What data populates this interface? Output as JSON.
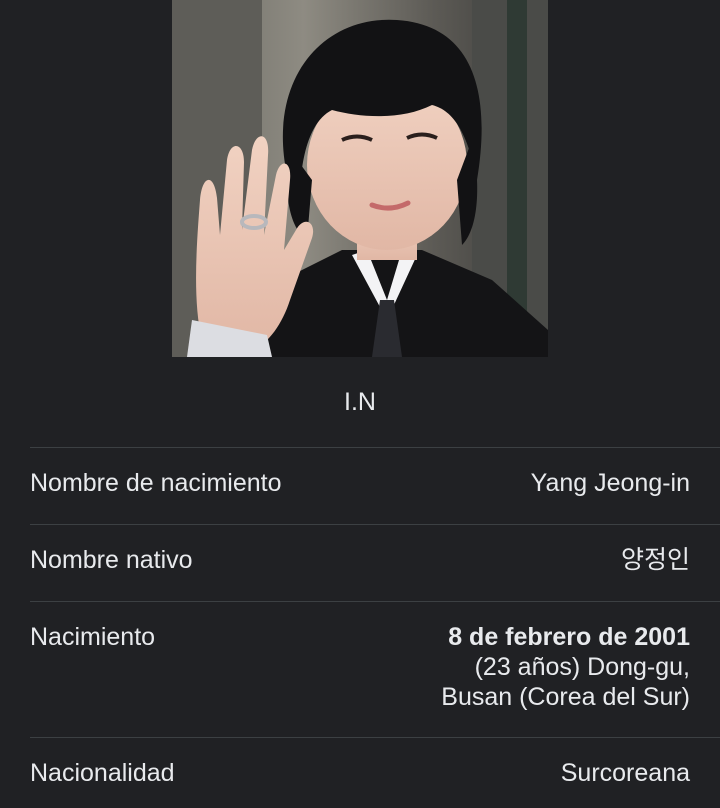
{
  "profile": {
    "name": "I.N",
    "photo_alt": "portrait-photo"
  },
  "facts": [
    {
      "label": "Nombre de nacimiento",
      "value": "Yang Jeong-in"
    },
    {
      "label": "Nombre nativo",
      "value": "양정인"
    },
    {
      "label": "Nacimiento",
      "value_strong": "8 de febrero de 2001",
      "value_line2": "(23 años) Dong-gu,",
      "value_line3": "Busan (Corea del Sur)"
    },
    {
      "label": "Nacionalidad",
      "value": "Surcoreana"
    }
  ],
  "colors": {
    "background": "#202124",
    "divider": "#3c4043",
    "text": "#e8eaed"
  }
}
